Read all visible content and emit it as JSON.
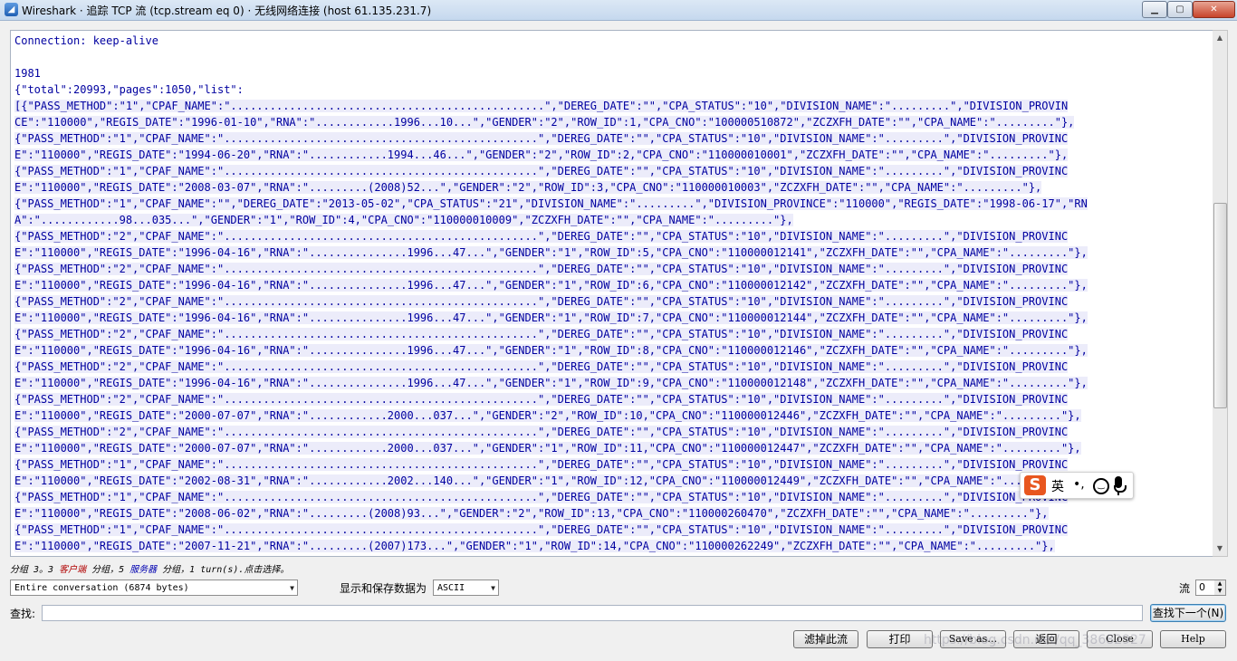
{
  "window": {
    "title": "Wireshark · 追踪 TCP 流 (tcp.stream eq 0) · 无线网络连接 (host 61.135.231.7)",
    "app_icon": "wireshark-fin-icon"
  },
  "stream_lines": [
    "Connection: keep-alive",
    "",
    "1981",
    "{\"total\":20993,\"pages\":1050,\"list\":",
    "[{\"PASS_METHOD\":\"1\",\"CPAF_NAME\":\"................................................\",\"DEREG_DATE\":\"\",\"CPA_STATUS\":\"10\",\"DIVISION_NAME\":\".........\",\"DIVISION_PROVIN",
    "CE\":\"110000\",\"REGIS_DATE\":\"1996-01-10\",\"RNA\":\"............1996...10...\",\"GENDER\":\"2\",\"ROW_ID\":1,\"CPA_CNO\":\"100000510872\",\"ZCZXFH_DATE\":\"\",\"CPA_NAME\":\".........\"},",
    "{\"PASS_METHOD\":\"1\",\"CPAF_NAME\":\"................................................\",\"DEREG_DATE\":\"\",\"CPA_STATUS\":\"10\",\"DIVISION_NAME\":\".........\",\"DIVISION_PROVINC",
    "E\":\"110000\",\"REGIS_DATE\":\"1994-06-20\",\"RNA\":\"............1994...46...\",\"GENDER\":\"2\",\"ROW_ID\":2,\"CPA_CNO\":\"110000010001\",\"ZCZXFH_DATE\":\"\",\"CPA_NAME\":\".........\"},",
    "{\"PASS_METHOD\":\"1\",\"CPAF_NAME\":\"................................................\",\"DEREG_DATE\":\"\",\"CPA_STATUS\":\"10\",\"DIVISION_NAME\":\".........\",\"DIVISION_PROVINC",
    "E\":\"110000\",\"REGIS_DATE\":\"2008-03-07\",\"RNA\":\".........(2008)52...\",\"GENDER\":\"2\",\"ROW_ID\":3,\"CPA_CNO\":\"110000010003\",\"ZCZXFH_DATE\":\"\",\"CPA_NAME\":\".........\"},",
    "{\"PASS_METHOD\":\"1\",\"CPAF_NAME\":\"\",\"DEREG_DATE\":\"2013-05-02\",\"CPA_STATUS\":\"21\",\"DIVISION_NAME\":\".........\",\"DIVISION_PROVINCE\":\"110000\",\"REGIS_DATE\":\"1998-06-17\",\"RN",
    "A\":\"............98...035...\",\"GENDER\":\"1\",\"ROW_ID\":4,\"CPA_CNO\":\"110000010009\",\"ZCZXFH_DATE\":\"\",\"CPA_NAME\":\".........\"},",
    "{\"PASS_METHOD\":\"2\",\"CPAF_NAME\":\"................................................\",\"DEREG_DATE\":\"\",\"CPA_STATUS\":\"10\",\"DIVISION_NAME\":\".........\",\"DIVISION_PROVINC",
    "E\":\"110000\",\"REGIS_DATE\":\"1996-04-16\",\"RNA\":\"...............1996...47...\",\"GENDER\":\"1\",\"ROW_ID\":5,\"CPA_CNO\":\"110000012141\",\"ZCZXFH_DATE\":\"\",\"CPA_NAME\":\".........\"},",
    "{\"PASS_METHOD\":\"2\",\"CPAF_NAME\":\"................................................\",\"DEREG_DATE\":\"\",\"CPA_STATUS\":\"10\",\"DIVISION_NAME\":\".........\",\"DIVISION_PROVINC",
    "E\":\"110000\",\"REGIS_DATE\":\"1996-04-16\",\"RNA\":\"...............1996...47...\",\"GENDER\":\"1\",\"ROW_ID\":6,\"CPA_CNO\":\"110000012142\",\"ZCZXFH_DATE\":\"\",\"CPA_NAME\":\".........\"},",
    "{\"PASS_METHOD\":\"2\",\"CPAF_NAME\":\"................................................\",\"DEREG_DATE\":\"\",\"CPA_STATUS\":\"10\",\"DIVISION_NAME\":\".........\",\"DIVISION_PROVINC",
    "E\":\"110000\",\"REGIS_DATE\":\"1996-04-16\",\"RNA\":\"...............1996...47...\",\"GENDER\":\"1\",\"ROW_ID\":7,\"CPA_CNO\":\"110000012144\",\"ZCZXFH_DATE\":\"\",\"CPA_NAME\":\".........\"},",
    "{\"PASS_METHOD\":\"2\",\"CPAF_NAME\":\"................................................\",\"DEREG_DATE\":\"\",\"CPA_STATUS\":\"10\",\"DIVISION_NAME\":\".........\",\"DIVISION_PROVINC",
    "E\":\"110000\",\"REGIS_DATE\":\"1996-04-16\",\"RNA\":\"...............1996...47...\",\"GENDER\":\"1\",\"ROW_ID\":8,\"CPA_CNO\":\"110000012146\",\"ZCZXFH_DATE\":\"\",\"CPA_NAME\":\".........\"},",
    "{\"PASS_METHOD\":\"2\",\"CPAF_NAME\":\"................................................\",\"DEREG_DATE\":\"\",\"CPA_STATUS\":\"10\",\"DIVISION_NAME\":\".........\",\"DIVISION_PROVINC",
    "E\":\"110000\",\"REGIS_DATE\":\"1996-04-16\",\"RNA\":\"...............1996...47...\",\"GENDER\":\"1\",\"ROW_ID\":9,\"CPA_CNO\":\"110000012148\",\"ZCZXFH_DATE\":\"\",\"CPA_NAME\":\".........\"},",
    "{\"PASS_METHOD\":\"2\",\"CPAF_NAME\":\"................................................\",\"DEREG_DATE\":\"\",\"CPA_STATUS\":\"10\",\"DIVISION_NAME\":\".........\",\"DIVISION_PROVINC",
    "E\":\"110000\",\"REGIS_DATE\":\"2000-07-07\",\"RNA\":\"............2000...037...\",\"GENDER\":\"2\",\"ROW_ID\":10,\"CPA_CNO\":\"110000012446\",\"ZCZXFH_DATE\":\"\",\"CPA_NAME\":\".........\"},",
    "{\"PASS_METHOD\":\"2\",\"CPAF_NAME\":\"................................................\",\"DEREG_DATE\":\"\",\"CPA_STATUS\":\"10\",\"DIVISION_NAME\":\".........\",\"DIVISION_PROVINC",
    "E\":\"110000\",\"REGIS_DATE\":\"2000-07-07\",\"RNA\":\"............2000...037...\",\"GENDER\":\"1\",\"ROW_ID\":11,\"CPA_CNO\":\"110000012447\",\"ZCZXFH_DATE\":\"\",\"CPA_NAME\":\".........\"},",
    "{\"PASS_METHOD\":\"1\",\"CPAF_NAME\":\"................................................\",\"DEREG_DATE\":\"\",\"CPA_STATUS\":\"10\",\"DIVISION_NAME\":\".........\",\"DIVISION_PROVINC",
    "E\":\"110000\",\"REGIS_DATE\":\"2002-08-31\",\"RNA\":\"............2002...140...\",\"GENDER\":\"1\",\"ROW_ID\":12,\"CPA_CNO\":\"110000012449\",\"ZCZXFH_DATE\":\"\",\"CPA_NAME\":\".........\"},",
    "{\"PASS_METHOD\":\"1\",\"CPAF_NAME\":\"................................................\",\"DEREG_DATE\":\"\",\"CPA_STATUS\":\"10\",\"DIVISION_NAME\":\".........\",\"DIVISION_PROVINC",
    "E\":\"110000\",\"REGIS_DATE\":\"2008-06-02\",\"RNA\":\".........(2008)93...\",\"GENDER\":\"2\",\"ROW_ID\":13,\"CPA_CNO\":\"110000260470\",\"ZCZXFH_DATE\":\"\",\"CPA_NAME\":\".........\"},",
    "{\"PASS_METHOD\":\"1\",\"CPAF_NAME\":\"................................................\",\"DEREG_DATE\":\"\",\"CPA_STATUS\":\"10\",\"DIVISION_NAME\":\".........\",\"DIVISION_PROVINC",
    "E\":\"110000\",\"REGIS_DATE\":\"2007-11-21\",\"RNA\":\".........(2007)173...\",\"GENDER\":\"1\",\"ROW_ID\":14,\"CPA_CNO\":\"110000262249\",\"ZCZXFH_DATE\":\"\",\"CPA_NAME\":\".........\"},"
  ],
  "status_bar": {
    "part1": "分组 3。3 ",
    "client": "客户端",
    "part2": " 分组，5 ",
    "server": "服务器",
    "part3": " 分组，1 turn(s).点击选择。"
  },
  "conversation_select": "Entire conversation (6874 bytes)",
  "display_format_label": "显示和保存数据为",
  "display_format_value": "ASCII",
  "stream_label": "流",
  "stream_value": "0",
  "find_label": "查找:",
  "find_placeholder": "",
  "find_next_label": "查找下一个(N)",
  "buttons": {
    "filter_out": "滤掉此流",
    "print": "打印",
    "save_as": "Save as…",
    "back": "返回",
    "close": "Close",
    "help": "Help"
  },
  "ime_toolbar": {
    "logo": "S",
    "mode": "英",
    "punct": "•,"
  },
  "watermark": "https://blog.csdn.net/qq_38682927"
}
